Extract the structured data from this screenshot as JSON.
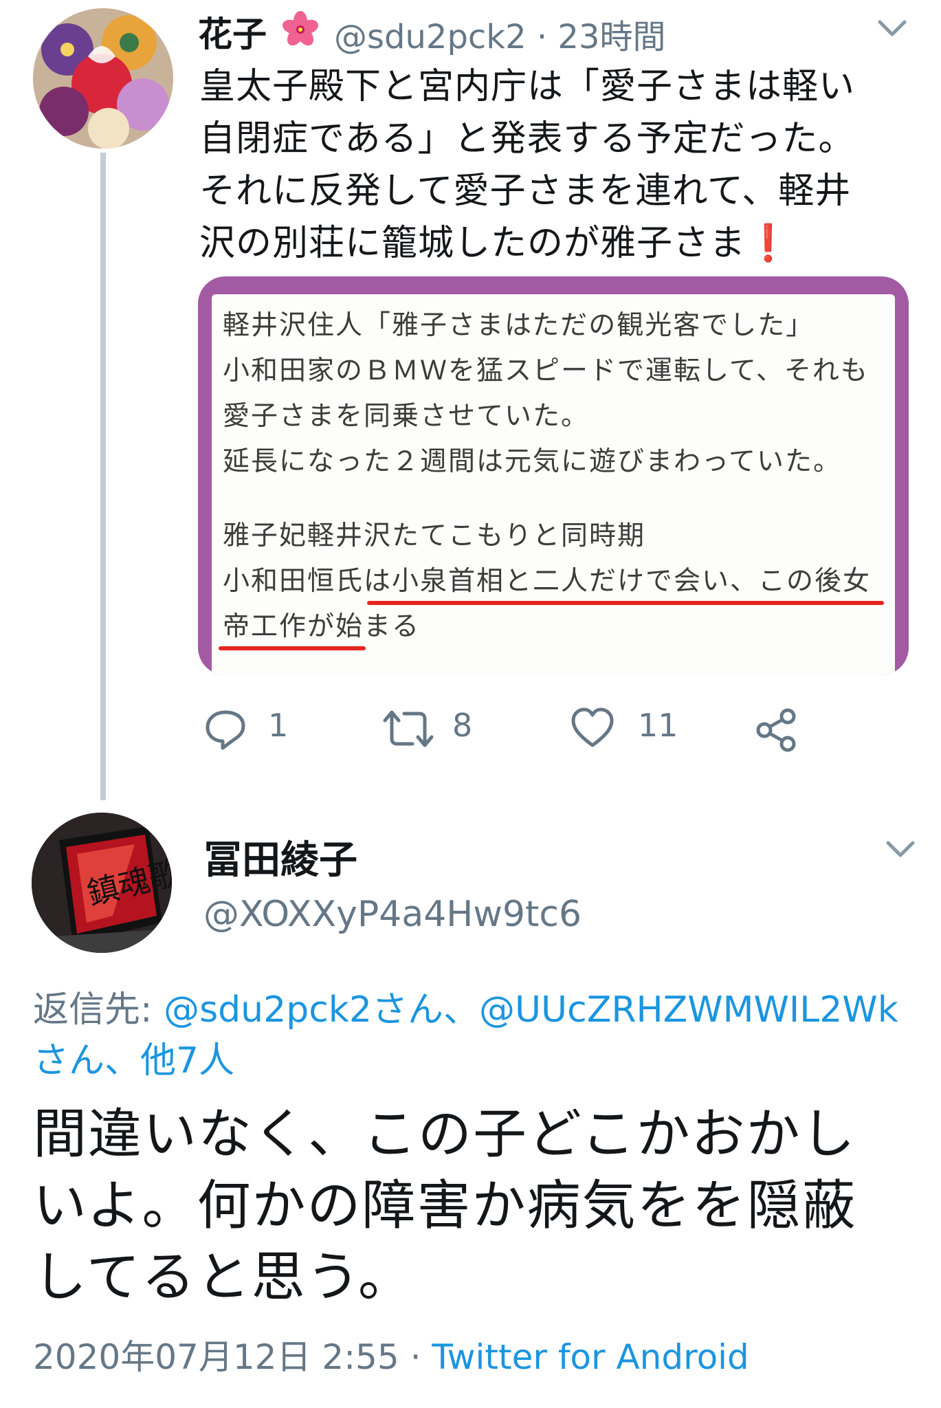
{
  "tweet1": {
    "name": "花子",
    "handle": "@sdu2pck2",
    "time_sep": " · ",
    "time": "23時間",
    "text": "皇太子殿下と宮内庁は「愛子さまは軽い\n自閉症である」と発表する予定だった。\nそれに反発して愛子さまを連れて、軽井\n沢の別荘に籠城したのが雅子さま",
    "exclaim": "❗",
    "media_lines": [
      "軽井沢住人「雅子さまはただの観光客でした」",
      "小和田家のＢＭＷを猛スピードで運転して、それも",
      "愛子さまを同乗させていた。",
      "延長になった２週間は元気に遊びまわっていた。",
      "雅子妃軽井沢たてこもりと同時期",
      "小和田恒氏は小泉首相と二人だけで会い、この後女",
      "帝工作が始まる"
    ],
    "actions": {
      "reply_count": "1",
      "retweet_count": "8",
      "like_count": "11"
    }
  },
  "reply": {
    "name": "冨田綾子",
    "handle": "@XOXXyP4a4Hw9tc6",
    "replying_prefix": "返信先: ",
    "replying_link1": "@sdu2pck2さん、@UUcZRHZWMWIL2Wk",
    "replying_link2": "さん、他7人",
    "text": "間違いなく、この子どこかおかし\nいよ。何かの障害か病気をを隠蔽\nしてると思う。",
    "date": "2020年07月12日 2:55",
    "sep": " · ",
    "client": "Twitter for Android",
    "book_title": "鎮魂歌"
  },
  "colors": {
    "link": "#1b95e0",
    "secondary": "#657786",
    "media_frame": "#a25aa3",
    "underline": "#e5261f",
    "thread_line": "#c6ccd2"
  },
  "icons": [
    "flower-emoji-icon",
    "chevron-down-icon",
    "reply-icon",
    "retweet-icon",
    "like-icon",
    "share-icon"
  ]
}
